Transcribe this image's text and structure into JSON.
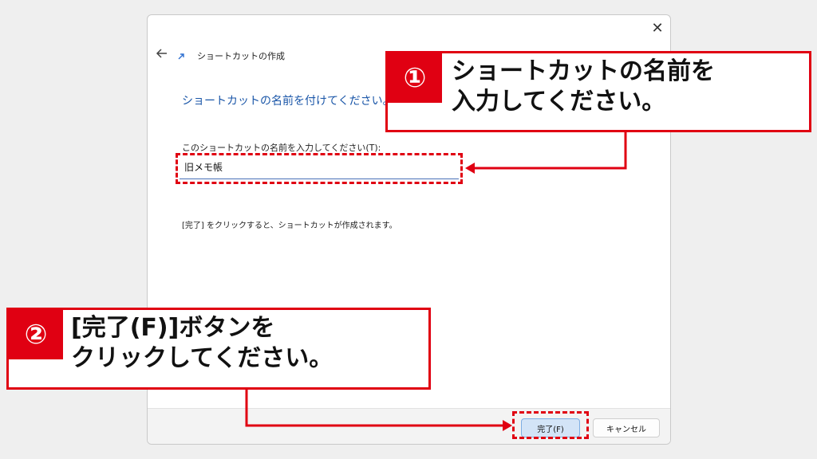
{
  "dialog": {
    "close_icon": "close-icon",
    "back_icon": "back-arrow-icon",
    "shortcut_icon": "shortcut-arrow-icon",
    "title": "ショートカットの作成",
    "heading": "ショートカットの名前を付けてください。",
    "name_label": "このショートカットの名前を入力してください(T):",
    "name_value": "旧メモ帳",
    "info": "[完了] をクリックすると、ショートカットが作成されます。",
    "finish_button": "完了(F)",
    "cancel_button": "キャンセル"
  },
  "annotations": {
    "color": "#e00012",
    "step1": {
      "number": "①",
      "text": "ショートカットの名前を\n入力してください。"
    },
    "step2": {
      "number": "②",
      "text": "[完了(F)]ボタンを\nクリックしてください。"
    }
  },
  "colors": {
    "heading": "#1a56a8",
    "finish_button_bg": "#d3e4f7",
    "accent_red": "#e00012"
  }
}
